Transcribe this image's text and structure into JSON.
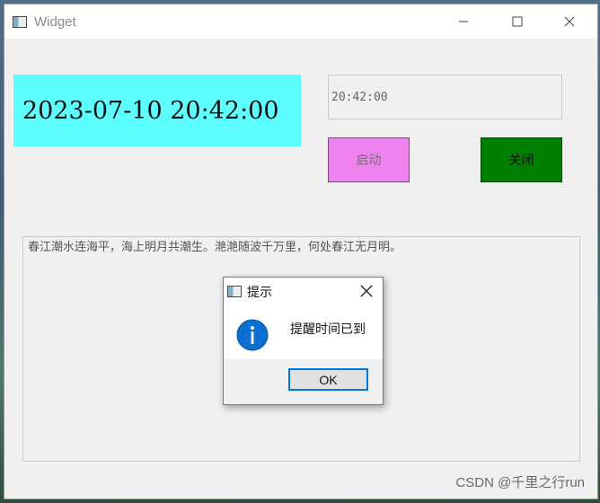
{
  "window": {
    "title": "Widget"
  },
  "datetime_display": "2023-07-10 20:42:00",
  "time_input": {
    "value": "20:42:00"
  },
  "buttons": {
    "start_label": "启动",
    "close_label": "关闭"
  },
  "text_area": {
    "content": "春江潮水连海平，海上明月共潮生。滟滟随波千万里，何处春江无月明。"
  },
  "dialog": {
    "title": "提示",
    "message": "提醒时间已到",
    "ok_label": "OK"
  },
  "watermark": "CSDN @千里之行run",
  "colors": {
    "datetime_bg": "#5dfefe",
    "start_button_bg": "#ee82ee",
    "close_button_bg": "#008000",
    "dialog_focus_border": "#0078d7",
    "info_icon": "#0a6fd1"
  }
}
